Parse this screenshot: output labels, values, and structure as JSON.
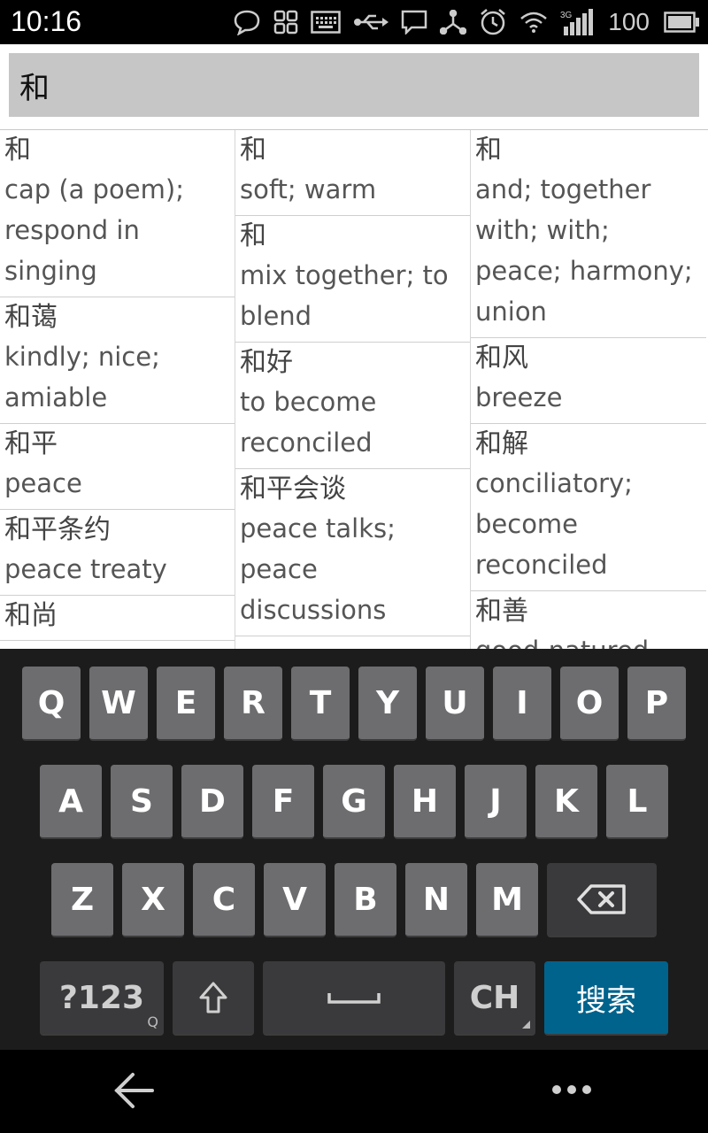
{
  "status": {
    "time": "10:16",
    "battery": "100",
    "network": "3G"
  },
  "search": {
    "value": "和"
  },
  "results": {
    "columns": [
      [
        {
          "hanzi": "和",
          "definition": "cap (a poem); respond in singing"
        },
        {
          "hanzi": "和蔼",
          "definition": "kindly; nice; amiable"
        },
        {
          "hanzi": "和平",
          "definition": "peace"
        },
        {
          "hanzi": "和平条约",
          "definition": "peace treaty"
        },
        {
          "hanzi": "和尚",
          "definition": ""
        }
      ],
      [
        {
          "hanzi": "和",
          "definition": "soft; warm"
        },
        {
          "hanzi": "和",
          "definition": "mix together; to blend"
        },
        {
          "hanzi": "和好",
          "definition": "to become reconciled"
        },
        {
          "hanzi": "和平会谈",
          "definition": "peace talks; peace discussions"
        }
      ],
      [
        {
          "hanzi": "和",
          "definition": "and; together with; with; peace; harmony; union"
        },
        {
          "hanzi": "和风",
          "definition": "breeze"
        },
        {
          "hanzi": "和解",
          "definition": "conciliatory; become reconciled"
        },
        {
          "hanzi": "和善",
          "definition": "good-natured"
        }
      ]
    ]
  },
  "keyboard": {
    "row1": [
      "Q",
      "W",
      "E",
      "R",
      "T",
      "Y",
      "U",
      "I",
      "O",
      "P"
    ],
    "row2": [
      "A",
      "S",
      "D",
      "F",
      "G",
      "H",
      "J",
      "K",
      "L"
    ],
    "row3": [
      "Z",
      "X",
      "C",
      "V",
      "B",
      "N",
      "M"
    ],
    "symbols_label": "?123",
    "symbols_sub": "Q",
    "lang_label": "CH",
    "search_label": "搜索",
    "colors": {
      "search_key": "#00638c",
      "letter_key": "#6d6d70",
      "function_key": "#3a3a3c"
    }
  },
  "icons": [
    "chat-bubble-icon",
    "apps-grid-icon",
    "keyboard-icon",
    "usb-icon",
    "message-icon",
    "share-icon",
    "alarm-icon",
    "wifi-icon",
    "signal-icon",
    "battery-icon",
    "back-icon",
    "menu-dots-icon"
  ]
}
